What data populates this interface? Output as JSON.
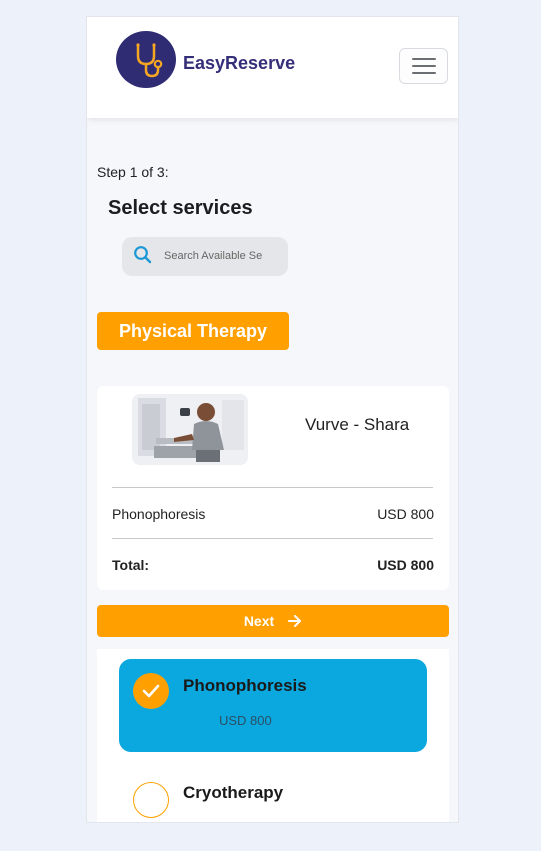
{
  "header": {
    "brand": "EasyReserve",
    "logo_icon": "stethoscope-icon",
    "menu_icon": "hamburger-icon"
  },
  "step": "Step 1 of 3:",
  "title": "Select services",
  "search": {
    "placeholder": "Search Available Se",
    "value": ""
  },
  "category": "Physical Therapy",
  "summary": {
    "provider_name": "Vurve - Shara",
    "items": [
      {
        "label": "Phonophoresis",
        "price": "USD 800"
      }
    ],
    "total_label": "Total:",
    "total_value": "USD 800"
  },
  "next_label": "Next",
  "services": [
    {
      "name": "Phonophoresis",
      "price": "USD 800",
      "selected": true
    },
    {
      "name": "Cryotherapy",
      "price": "",
      "selected": false
    }
  ],
  "colors": {
    "accent": "#ffa000",
    "selected_card": "#0aa8de",
    "brand": "#352e79",
    "background": "#edf1f9"
  }
}
